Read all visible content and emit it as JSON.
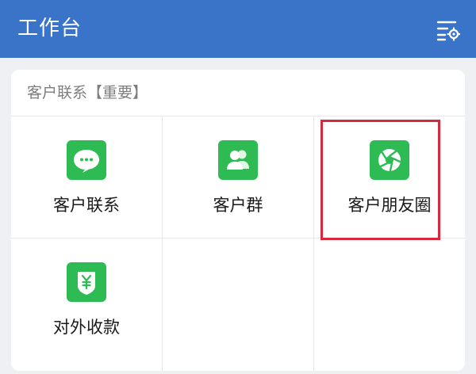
{
  "header": {
    "title": "工作台",
    "settings_icon": "list-settings-icon"
  },
  "section": {
    "title": "客户联系【重要】",
    "items": [
      {
        "label": "客户联系",
        "icon": "chat-bubble-icon"
      },
      {
        "label": "客户群",
        "icon": "group-icon"
      },
      {
        "label": "客户朋友圈",
        "icon": "aperture-icon"
      },
      {
        "label": "对外收款",
        "icon": "yuan-shield-icon"
      }
    ]
  },
  "colors": {
    "header_bg": "#3a74c8",
    "icon_green": "#2fbb54",
    "highlight_red": "#d8283b",
    "page_bg": "#eef0f4"
  }
}
